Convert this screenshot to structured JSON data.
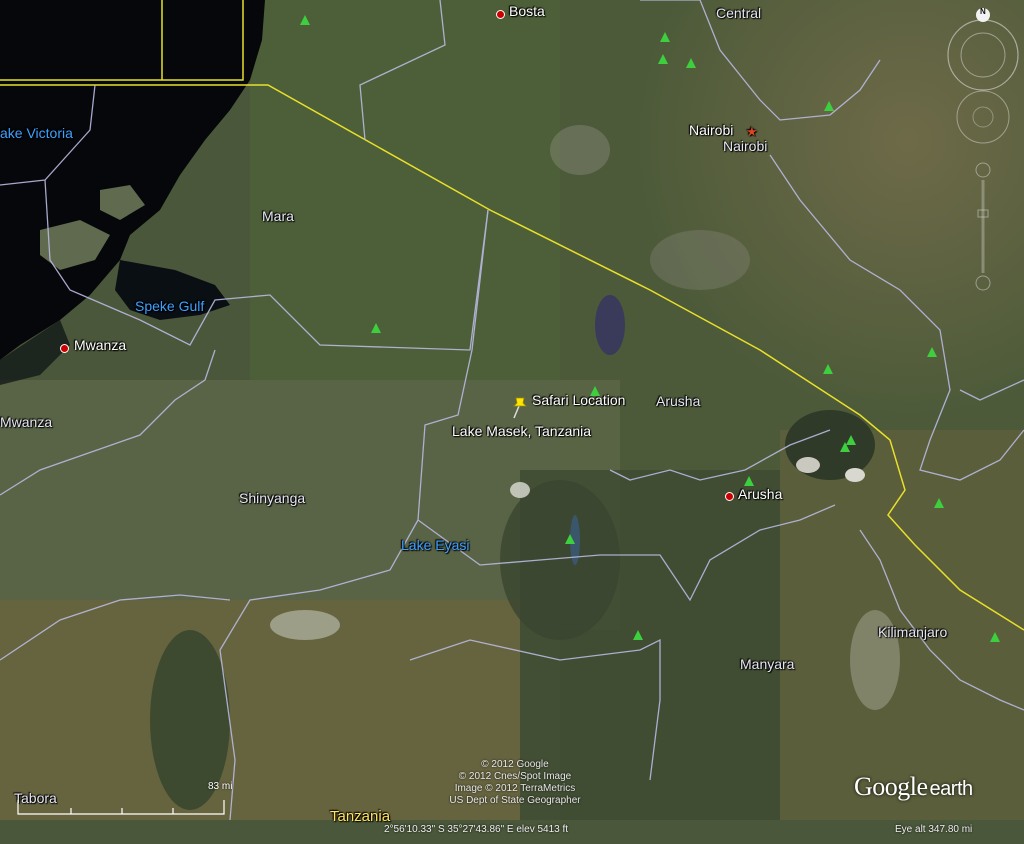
{
  "labels": {
    "lake_victoria": "ake Victoria",
    "speke_gulf": "Speke Gulf",
    "lake_eyasi": "Lake Eyasi",
    "bosta": "Bosta",
    "central": "Central",
    "nairobi_city": "Nairobi",
    "nairobi_region": "Nairobi",
    "mara": "Mara",
    "mwanza_city": "Mwanza",
    "mwanza_region": "Mwanza",
    "shinyanga": "Shinyanga",
    "arusha_region": "Arusha",
    "arusha_city": "Arusha",
    "kilimanjaro": "Kilimanjaro",
    "manyara": "Manyara",
    "tabora": "Tabora",
    "tanzania": "Tanzania"
  },
  "placemark": {
    "name": "Safari Location",
    "description": "Lake Masek, Tanzania",
    "icon": "yellow-pushpin-icon"
  },
  "credits": [
    "© 2012 Google",
    "© 2012 Cnes/Spot Image",
    "Image © 2012 TerraMetrics",
    "US Dept of State Geographer"
  ],
  "status": {
    "coords": "2°56'10.33\" S   35°27'43.86\" E  elev  5413 ft",
    "eye_alt": "Eye alt   347.80 mi"
  },
  "scale": {
    "label": "83 mi"
  },
  "logo": {
    "google": "Google",
    "earth": "earth"
  },
  "nav": {
    "north": "N"
  },
  "colors": {
    "border": "#e8e02a",
    "admin_lines": "#b9b9e0",
    "water": "#3fa1ff",
    "park_icon": "#3ecf3e"
  }
}
